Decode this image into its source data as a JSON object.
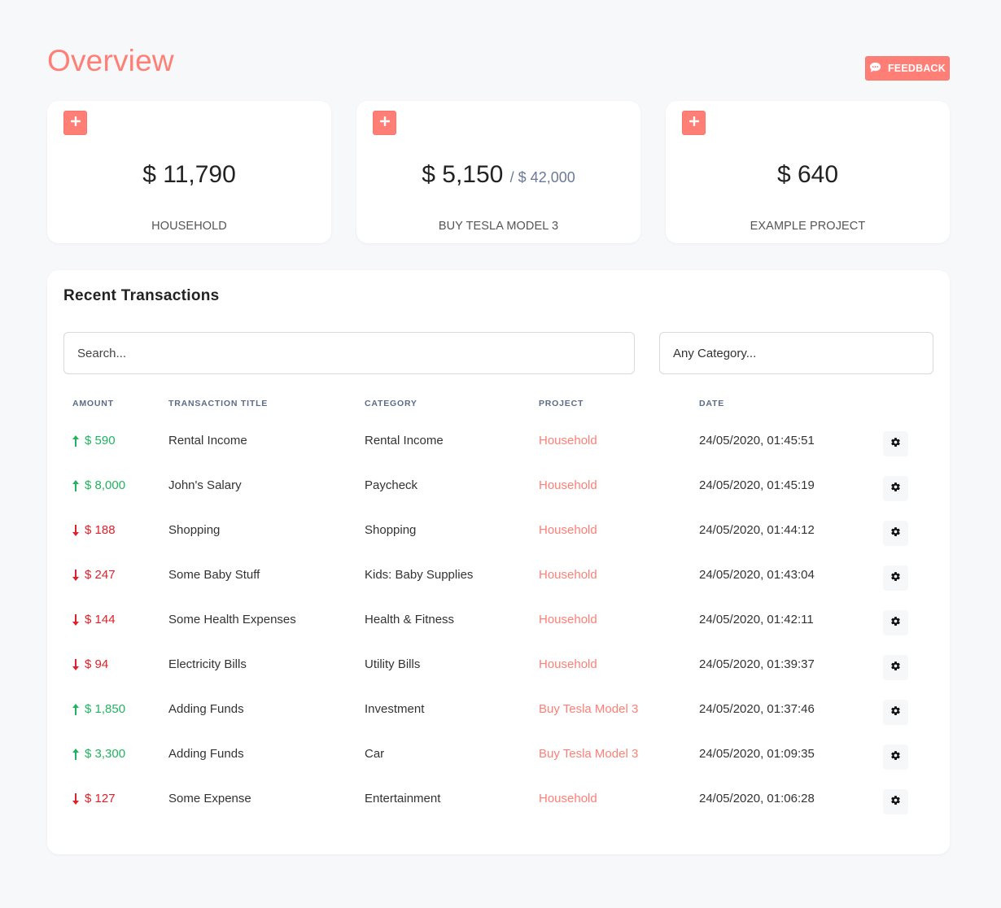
{
  "header": {
    "title": "Overview",
    "feedback_label": "FEEDBACK",
    "feedback_icon": "comment-dots-icon",
    "accent_color": "#ff7f76"
  },
  "project_cards": [
    {
      "amount": "$ 11,790",
      "goal": "",
      "label": "HOUSEHOLD",
      "add_icon": "plus-icon"
    },
    {
      "amount": "$ 5,150",
      "goal": "/ $ 42,000",
      "label": "BUY TESLA MODEL 3",
      "add_icon": "plus-icon"
    },
    {
      "amount": "$ 640",
      "goal": "",
      "label": "EXAMPLE PROJECT",
      "add_icon": "plus-icon"
    }
  ],
  "transactions": {
    "title": "Recent Transactions",
    "search_placeholder": "Search...",
    "category_filter": "Any Category...",
    "columns": [
      "AMOUNT",
      "TRANSACTION TITLE",
      "CATEGORY",
      "PROJECT",
      "DATE"
    ],
    "income_color": "#22b35e",
    "expense_color": "#e0202a",
    "rows": [
      {
        "direction": "up",
        "amount": "$ 590",
        "title": "Rental Income",
        "category": "Rental Income",
        "project": "Household",
        "date": "24/05/2020, 01:45:51"
      },
      {
        "direction": "up",
        "amount": "$ 8,000",
        "title": "John's Salary",
        "category": "Paycheck",
        "project": "Household",
        "date": "24/05/2020, 01:45:19"
      },
      {
        "direction": "down",
        "amount": "$ 188",
        "title": "Shopping",
        "category": "Shopping",
        "project": "Household",
        "date": "24/05/2020, 01:44:12"
      },
      {
        "direction": "down",
        "amount": "$ 247",
        "title": "Some Baby Stuff",
        "category": "Kids: Baby Supplies",
        "project": "Household",
        "date": "24/05/2020, 01:43:04"
      },
      {
        "direction": "down",
        "amount": "$ 144",
        "title": "Some Health Expenses",
        "category": "Health & Fitness",
        "project": "Household",
        "date": "24/05/2020, 01:42:11"
      },
      {
        "direction": "down",
        "amount": "$ 94",
        "title": "Electricity Bills",
        "category": "Utility Bills",
        "project": "Household",
        "date": "24/05/2020, 01:39:37"
      },
      {
        "direction": "up",
        "amount": "$ 1,850",
        "title": "Adding Funds",
        "category": "Investment",
        "project": "Buy Tesla Model 3",
        "date": "24/05/2020, 01:37:46"
      },
      {
        "direction": "up",
        "amount": "$ 3,300",
        "title": "Adding Funds",
        "category": "Car",
        "project": "Buy Tesla Model 3",
        "date": "24/05/2020, 01:09:35"
      },
      {
        "direction": "down",
        "amount": "$ 127",
        "title": "Some Expense",
        "category": "Entertainment",
        "project": "Household",
        "date": "24/05/2020, 01:06:28"
      }
    ]
  }
}
